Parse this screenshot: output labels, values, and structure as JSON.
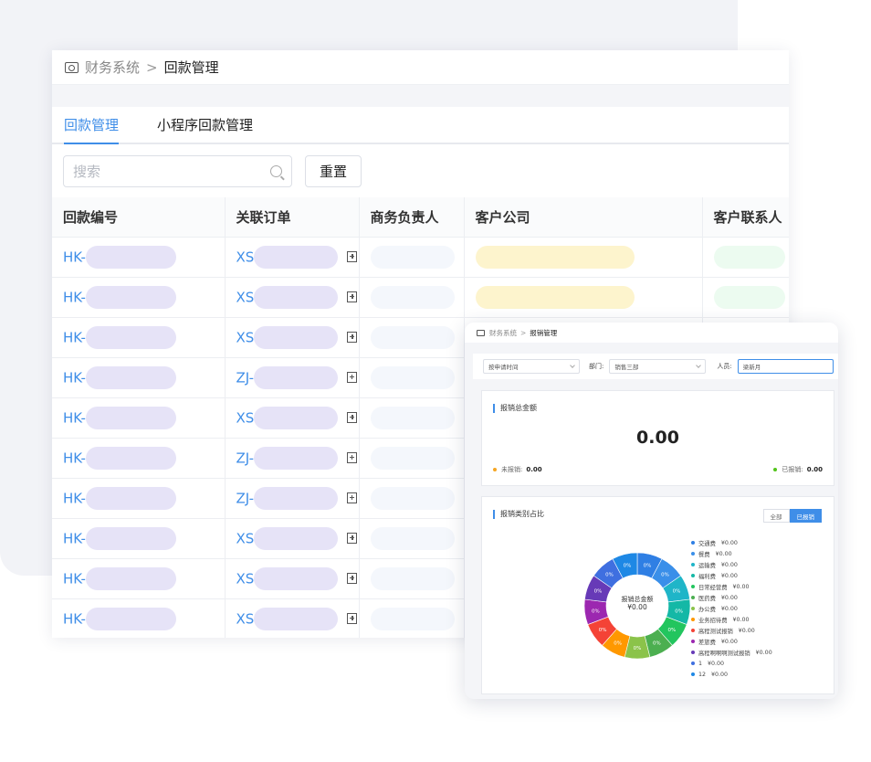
{
  "main": {
    "breadcrumb": {
      "root": "财务系统",
      "separator": ">",
      "current": "回款管理"
    },
    "tabs": [
      {
        "label": "回款管理",
        "active": true
      },
      {
        "label": "小程序回款管理",
        "active": false
      }
    ],
    "search": {
      "placeholder": "搜索"
    },
    "reset_label": "重置",
    "columns": [
      "回款编号",
      "关联订单",
      "商务负责人",
      "客户公司",
      "客户联系人"
    ],
    "rows": [
      {
        "id_prefix": "HK-",
        "order_prefix": "XS"
      },
      {
        "id_prefix": "HK-",
        "order_prefix": "XS"
      },
      {
        "id_prefix": "HK-",
        "order_prefix": "XS"
      },
      {
        "id_prefix": "HK-",
        "order_prefix": "ZJ-"
      },
      {
        "id_prefix": "HK-",
        "order_prefix": "XS"
      },
      {
        "id_prefix": "HK-",
        "order_prefix": "ZJ-"
      },
      {
        "id_prefix": "HK-",
        "order_prefix": "ZJ-"
      },
      {
        "id_prefix": "HK-",
        "order_prefix": "XS"
      },
      {
        "id_prefix": "HK-",
        "order_prefix": "XS"
      },
      {
        "id_prefix": "HK-",
        "order_prefix": "XS"
      }
    ]
  },
  "expense": {
    "breadcrumb": {
      "root": "财务系统",
      "separator": ">",
      "current": "报销管理"
    },
    "filter": {
      "time_select": "按申请时间",
      "dept_label": "部门:",
      "dept_select": "销售三部",
      "person_label": "人员:",
      "person_value": "梁新月"
    },
    "total_card": {
      "title": "报销总金额",
      "amount": "0.00",
      "unpaid_label": "未报销:",
      "unpaid_value": "0.00",
      "paid_label": "已报销:",
      "paid_value": "0.00"
    },
    "category_card": {
      "title": "报销类别占比",
      "toggle_all": "全部",
      "toggle_paid": "已报销",
      "center_label": "报销总金额",
      "center_value": "¥0.00",
      "slice_label": "0%"
    },
    "colors": {
      "accent": "#3f8ee8",
      "unpaid_dot": "#f5a623",
      "paid_dot": "#52c41a"
    }
  },
  "chart_data": {
    "type": "pie",
    "title": "报销类别占比",
    "center_label": "报销总金额",
    "center_value": "¥0.00",
    "slices": [
      {
        "name": "交通费",
        "amount": "¥0.00",
        "percent": "0%",
        "color": "#2f7fe4"
      },
      {
        "name": "餐费",
        "amount": "¥0.00",
        "percent": "0%",
        "color": "#3a8fe9"
      },
      {
        "name": "运输费",
        "amount": "¥0.00",
        "percent": "0%",
        "color": "#1fb5c8"
      },
      {
        "name": "福利费",
        "amount": "¥0.00",
        "percent": "0%",
        "color": "#14b8a6"
      },
      {
        "name": "日常经营费",
        "amount": "¥0.00",
        "percent": "0%",
        "color": "#22c55e"
      },
      {
        "name": "医药费",
        "amount": "¥0.00",
        "percent": "0%",
        "color": "#4caf50"
      },
      {
        "name": "办公费",
        "amount": "¥0.00",
        "percent": "0%",
        "color": "#8bc34a"
      },
      {
        "name": "业务招待费",
        "amount": "¥0.00",
        "percent": "0%",
        "color": "#ff9800"
      },
      {
        "name": "高程测试报销",
        "amount": "¥0.00",
        "percent": "0%",
        "color": "#f44336"
      },
      {
        "name": "差旅费",
        "amount": "¥0.00",
        "percent": "0%",
        "color": "#9c27b0"
      },
      {
        "name": "高程啊啊啊测试报销",
        "amount": "¥0.00",
        "percent": "0%",
        "color": "#673ab7"
      },
      {
        "name": "1",
        "amount": "¥0.00",
        "percent": "0%",
        "color": "#3f6fe0"
      },
      {
        "name": "12",
        "amount": "¥0.00",
        "percent": "0%",
        "color": "#1e88e5"
      }
    ]
  }
}
